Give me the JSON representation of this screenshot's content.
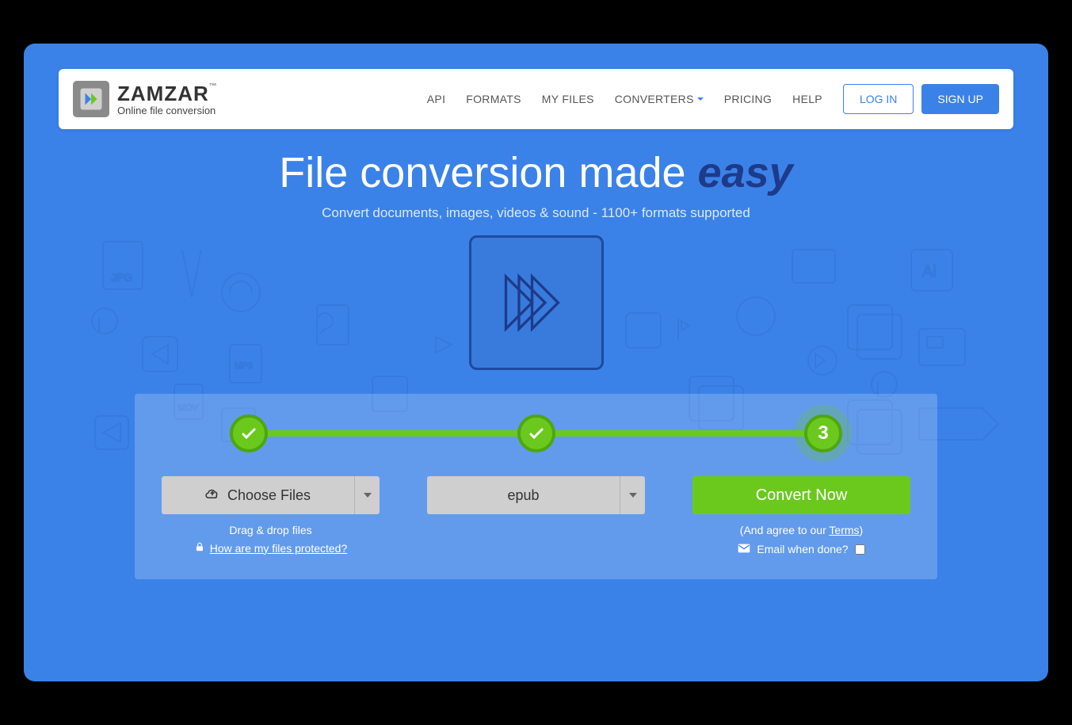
{
  "brand": {
    "name": "ZAMZAR",
    "tag": "Online file conversion",
    "tm": "™"
  },
  "nav": {
    "api": "API",
    "formats": "FORMATS",
    "myfiles": "MY FILES",
    "converters": "CONVERTERS",
    "pricing": "PRICING",
    "help": "HELP",
    "login": "LOG IN",
    "signup": "SIGN UP"
  },
  "hero": {
    "title_a": "File conversion made ",
    "title_em": "easy",
    "sub": "Convert documents, images, videos & sound - 1100+ formats supported"
  },
  "steps": {
    "step3": "3"
  },
  "panel": {
    "choose": "Choose Files",
    "format_selected": "epub",
    "convert": "Convert Now",
    "drag": "Drag & drop files",
    "protected": "How are my files protected?",
    "agree_a": "(And agree to our ",
    "agree_link": "Terms",
    "agree_b": ")",
    "email": "Email when done?"
  }
}
